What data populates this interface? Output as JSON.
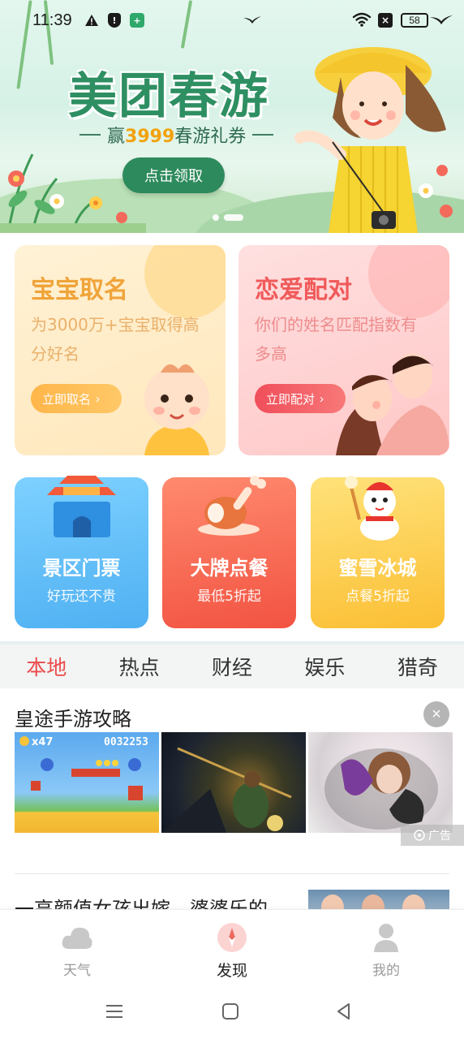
{
  "status_bar": {
    "time": "11:39",
    "battery": "58",
    "warning_glyph": "!",
    "alert_glyph": "!",
    "app_glyph": "+",
    "x_glyph": "×"
  },
  "banner": {
    "title": "美团春游",
    "subtitle_prefix": "赢",
    "subtitle_highlight": "3999",
    "subtitle_suffix": "春游礼券",
    "button_label": "点击领取",
    "title_color": "#2e8f62",
    "highlight_color": "#f2a20e"
  },
  "feature_cards": [
    {
      "title": "宝宝取名",
      "desc": "为3000万+宝宝取得高分好名",
      "button_label": "立即取名",
      "chevron": "›"
    },
    {
      "title": "恋爱配对",
      "desc": "你们的姓名匹配指数有多高",
      "button_label": "立即配对",
      "chevron": "›"
    }
  ],
  "tiles": [
    {
      "title": "景区门票",
      "subtitle": "好玩还不贵"
    },
    {
      "title": "大牌点餐",
      "subtitle": "最低5折起"
    },
    {
      "title": "蜜雪冰城",
      "subtitle": "点餐5折起"
    }
  ],
  "tabs": [
    "本地",
    "热点",
    "财经",
    "娱乐",
    "猎奇"
  ],
  "active_tab": "本地",
  "accent_color": "#ec4a4a",
  "feed": {
    "ad": {
      "title": "皇途手游攻略",
      "close_glyph": "×",
      "badge_label": "广告",
      "game_lives": "x47",
      "game_score": "0032253"
    },
    "news": {
      "title": "一高颜值女孩出嫁，婆婆乐的"
    }
  },
  "bottom_nav": [
    {
      "label": "天气",
      "icon": "cloud-icon",
      "active": false
    },
    {
      "label": "发现",
      "icon": "compass-icon",
      "active": true
    },
    {
      "label": "我的",
      "icon": "user-icon",
      "active": false
    }
  ],
  "system_nav": [
    "menu-icon",
    "home-icon",
    "back-icon"
  ]
}
